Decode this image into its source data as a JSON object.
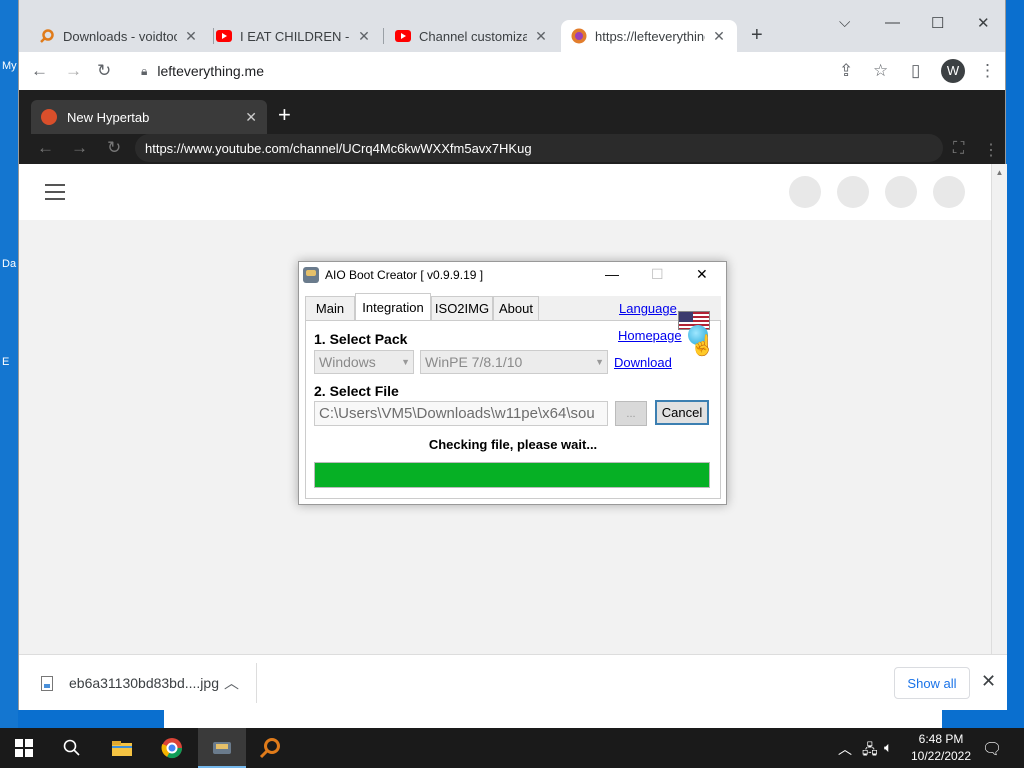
{
  "desktop": {
    "labels": [
      "My",
      "Da",
      "E"
    ]
  },
  "browser": {
    "tabs": [
      {
        "title": "Downloads - voidtools",
        "icon": "search-icon"
      },
      {
        "title": "I EAT CHILDREN - YouTube",
        "icon": "youtube-icon"
      },
      {
        "title": "Channel customization",
        "icon": "youtube-icon"
      },
      {
        "title": "https://lefteverything.me",
        "icon": "hypertab-icon"
      }
    ],
    "address": "lefteverything.me",
    "profile_initial": "W"
  },
  "hypertab": {
    "tab_title": "New Hypertab",
    "address": "https://www.youtube.com/channel/UCrq4Mc6kwWXXfm5avx7HKug"
  },
  "download": {
    "filename": "eb6a31130bd83bd....jpg",
    "show_all": "Show all"
  },
  "dialog": {
    "title": "AIO Boot Creator [ v0.9.9.19 ]",
    "tabs": [
      "Main",
      "Integration",
      "ISO2IMG",
      "About"
    ],
    "active_tab": "Integration",
    "language_link": "Language",
    "homepage_link": "Homepage",
    "download_link": "Download",
    "select_pack_label": "1. Select Pack",
    "pack_os": "Windows",
    "pack_type": "WinPE 7/8.1/10",
    "select_file_label": "2. Select File",
    "file_path": "C:\\Users\\VM5\\Downloads\\w11pe\\x64\\sou",
    "browse_label": "...",
    "cancel_label": "Cancel",
    "status": "Checking file, please wait...",
    "progress": 1.0,
    "progress_color": "#06b025"
  },
  "taskbar": {
    "time": "6:48 PM",
    "date": "10/22/2022"
  }
}
